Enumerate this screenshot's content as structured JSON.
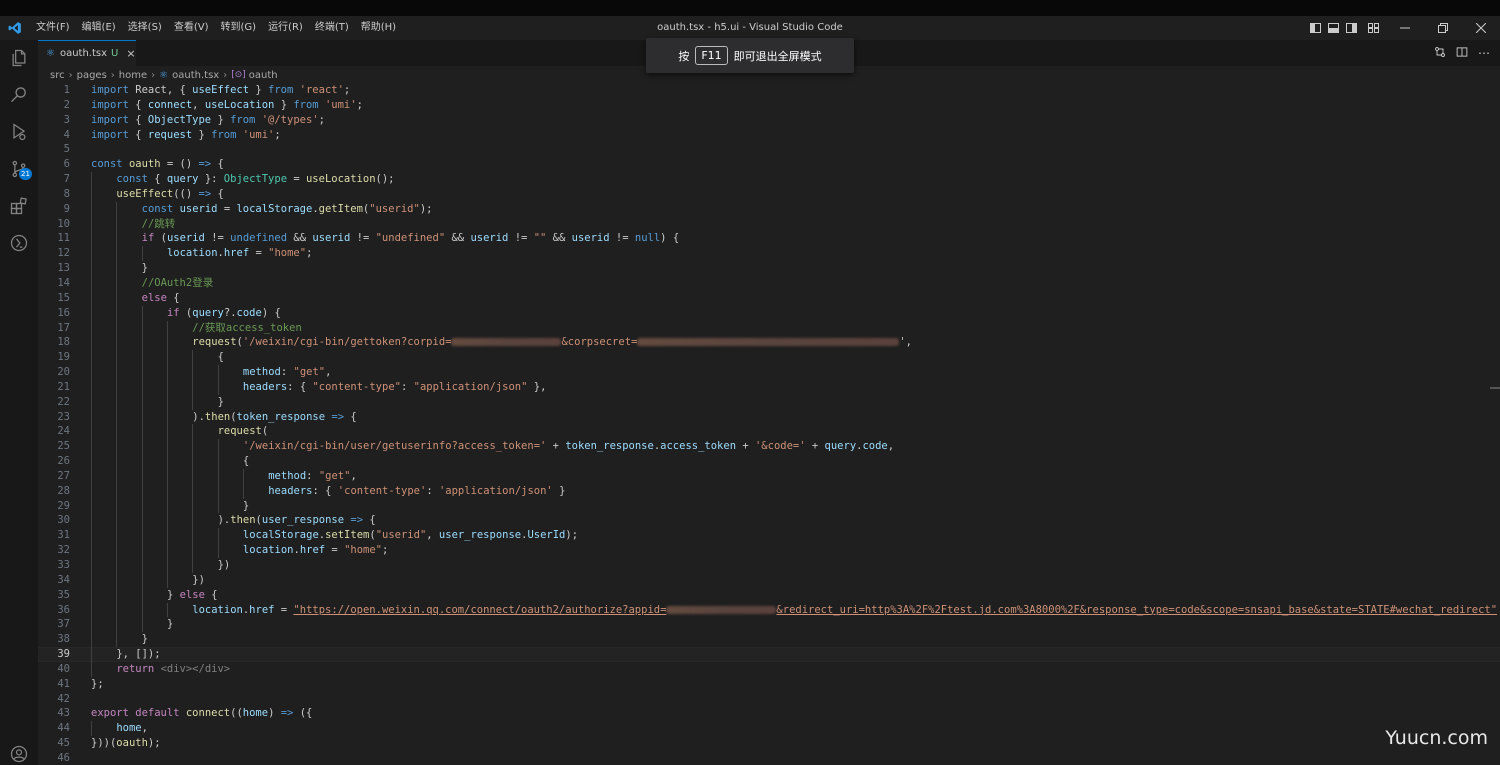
{
  "titlebar": {
    "title": "oauth.tsx - h5.ui - Visual Studio Code",
    "menu": [
      "文件(F)",
      "编辑(E)",
      "选择(S)",
      "查看(V)",
      "转到(G)",
      "运行(R)",
      "终端(T)",
      "帮助(H)"
    ]
  },
  "activitybar": {
    "scm_badge": "21",
    "icons": [
      "explorer-icon",
      "search-icon",
      "run-debug-icon",
      "source-control-icon",
      "extensions-icon",
      "remote-icon",
      "account-icon"
    ]
  },
  "tab": {
    "filename": "oauth.tsx",
    "modified": "U",
    "close": "×"
  },
  "breadcrumb": {
    "items": [
      "src",
      "pages",
      "home",
      "oauth.tsx",
      "oauth"
    ]
  },
  "toast": {
    "prefix": "按",
    "key": "F11",
    "suffix": "即可退出全屏模式"
  },
  "watermark": "Yuucn.com",
  "colors": {
    "keyword": "#569cd6",
    "control": "#c586c0",
    "string": "#ce9178",
    "comment": "#6a9955",
    "function": "#dcdcaa",
    "variable": "#9cdcfe",
    "type": "#4ec9b0",
    "text": "#cccccc",
    "accent": "#0078d4"
  },
  "code": {
    "current_line": 39,
    "lines": [
      {
        "n": 1,
        "indent": 0,
        "tokens": [
          [
            "import",
            "kw"
          ],
          [
            " React, { ",
            "t"
          ],
          [
            "useEffect",
            "var"
          ],
          [
            " } ",
            "t"
          ],
          [
            "from",
            "kw"
          ],
          [
            " ",
            "t"
          ],
          [
            "'react'",
            "str"
          ],
          [
            ";",
            "t"
          ]
        ]
      },
      {
        "n": 2,
        "indent": 0,
        "tokens": [
          [
            "import",
            "kw"
          ],
          [
            " { ",
            "t"
          ],
          [
            "connect",
            "var"
          ],
          [
            ", ",
            "t"
          ],
          [
            "useLocation",
            "var"
          ],
          [
            " } ",
            "t"
          ],
          [
            "from",
            "kw"
          ],
          [
            " ",
            "t"
          ],
          [
            "'umi'",
            "str"
          ],
          [
            ";",
            "t"
          ]
        ]
      },
      {
        "n": 3,
        "indent": 0,
        "tokens": [
          [
            "import",
            "kw"
          ],
          [
            " { ",
            "t"
          ],
          [
            "ObjectType",
            "var"
          ],
          [
            " } ",
            "t"
          ],
          [
            "from",
            "kw"
          ],
          [
            " ",
            "t"
          ],
          [
            "'@/types'",
            "str"
          ],
          [
            ";",
            "t"
          ]
        ]
      },
      {
        "n": 4,
        "indent": 0,
        "tokens": [
          [
            "import",
            "kw"
          ],
          [
            " { ",
            "t"
          ],
          [
            "request",
            "var"
          ],
          [
            " } ",
            "t"
          ],
          [
            "from",
            "kw"
          ],
          [
            " ",
            "t"
          ],
          [
            "'umi'",
            "str"
          ],
          [
            ";",
            "t"
          ]
        ]
      },
      {
        "n": 5,
        "indent": 0,
        "tokens": []
      },
      {
        "n": 6,
        "indent": 0,
        "tokens": [
          [
            "const",
            "kw"
          ],
          [
            " ",
            "t"
          ],
          [
            "oauth",
            "fn"
          ],
          [
            " = () ",
            "t"
          ],
          [
            "=>",
            "kw"
          ],
          [
            " {",
            "t"
          ]
        ]
      },
      {
        "n": 7,
        "indent": 1,
        "tokens": [
          [
            "const",
            "kw"
          ],
          [
            " { ",
            "t"
          ],
          [
            "query",
            "var"
          ],
          [
            " }: ",
            "t"
          ],
          [
            "ObjectType",
            "type"
          ],
          [
            " = ",
            "t"
          ],
          [
            "useLocation",
            "fn"
          ],
          [
            "();",
            "t"
          ]
        ]
      },
      {
        "n": 8,
        "indent": 1,
        "tokens": [
          [
            "useEffect",
            "fn"
          ],
          [
            "(() ",
            "t"
          ],
          [
            "=>",
            "kw"
          ],
          [
            " {",
            "t"
          ]
        ]
      },
      {
        "n": 9,
        "indent": 2,
        "tokens": [
          [
            "const",
            "kw"
          ],
          [
            " ",
            "t"
          ],
          [
            "userid",
            "var"
          ],
          [
            " = ",
            "t"
          ],
          [
            "localStorage",
            "var"
          ],
          [
            ".",
            "t"
          ],
          [
            "getItem",
            "fn"
          ],
          [
            "(",
            "t"
          ],
          [
            "\"userid\"",
            "str"
          ],
          [
            ");",
            "t"
          ]
        ]
      },
      {
        "n": 10,
        "indent": 2,
        "tokens": [
          [
            "//跳转",
            "com"
          ]
        ]
      },
      {
        "n": 11,
        "indent": 2,
        "tokens": [
          [
            "if",
            "ctl"
          ],
          [
            " (",
            "t"
          ],
          [
            "userid",
            "var"
          ],
          [
            " != ",
            "t"
          ],
          [
            "undefined",
            "kw"
          ],
          [
            " && ",
            "t"
          ],
          [
            "userid",
            "var"
          ],
          [
            " != ",
            "t"
          ],
          [
            "\"undefined\"",
            "str"
          ],
          [
            " && ",
            "t"
          ],
          [
            "userid",
            "var"
          ],
          [
            " != ",
            "t"
          ],
          [
            "\"\"",
            "str"
          ],
          [
            " && ",
            "t"
          ],
          [
            "userid",
            "var"
          ],
          [
            " != ",
            "t"
          ],
          [
            "null",
            "kw"
          ],
          [
            ") {",
            "t"
          ]
        ]
      },
      {
        "n": 12,
        "indent": 3,
        "tokens": [
          [
            "location",
            "var"
          ],
          [
            ".",
            "t"
          ],
          [
            "href",
            "var"
          ],
          [
            " = ",
            "t"
          ],
          [
            "\"home\"",
            "str"
          ],
          [
            ";",
            "t"
          ]
        ]
      },
      {
        "n": 13,
        "indent": 2,
        "tokens": [
          [
            "}",
            "t"
          ]
        ]
      },
      {
        "n": 14,
        "indent": 2,
        "tokens": [
          [
            "//OAuth2登录",
            "com"
          ]
        ]
      },
      {
        "n": 15,
        "indent": 2,
        "tokens": [
          [
            "else",
            "ctl"
          ],
          [
            " {",
            "t"
          ]
        ]
      },
      {
        "n": 16,
        "indent": 3,
        "tokens": [
          [
            "if",
            "ctl"
          ],
          [
            " (",
            "t"
          ],
          [
            "query",
            "var"
          ],
          [
            "?.",
            "t"
          ],
          [
            "code",
            "var"
          ],
          [
            ") {",
            "t"
          ]
        ]
      },
      {
        "n": 17,
        "indent": 4,
        "tokens": [
          [
            "//获取access_token",
            "com"
          ]
        ]
      },
      {
        "n": 18,
        "indent": 4,
        "tokens": [
          [
            "request",
            "fn"
          ],
          [
            "(",
            "t"
          ],
          [
            "'/weixin/cgi-bin/gettoken?corpid=",
            "str"
          ],
          [
            "",
            "blur:110"
          ],
          [
            "&corpsecret=",
            "str"
          ],
          [
            "",
            "blur:262"
          ],
          [
            "',",
            "t"
          ]
        ]
      },
      {
        "n": 19,
        "indent": 5,
        "tokens": [
          [
            "{",
            "t"
          ]
        ]
      },
      {
        "n": 20,
        "indent": 6,
        "tokens": [
          [
            "method",
            "var"
          ],
          [
            ": ",
            "t"
          ],
          [
            "\"get\"",
            "str"
          ],
          [
            ",",
            "t"
          ]
        ]
      },
      {
        "n": 21,
        "indent": 6,
        "tokens": [
          [
            "headers",
            "var"
          ],
          [
            ": { ",
            "t"
          ],
          [
            "\"content-type\"",
            "str"
          ],
          [
            ": ",
            "t"
          ],
          [
            "\"application/json\"",
            "str"
          ],
          [
            " },",
            "t"
          ]
        ]
      },
      {
        "n": 22,
        "indent": 5,
        "tokens": [
          [
            "}",
            "t"
          ]
        ]
      },
      {
        "n": 23,
        "indent": 4,
        "tokens": [
          [
            ").",
            "t"
          ],
          [
            "then",
            "fn"
          ],
          [
            "(",
            "t"
          ],
          [
            "token_response",
            "var"
          ],
          [
            " ",
            "t"
          ],
          [
            "=>",
            "kw"
          ],
          [
            " {",
            "t"
          ]
        ]
      },
      {
        "n": 24,
        "indent": 5,
        "tokens": [
          [
            "request",
            "fn"
          ],
          [
            "(",
            "t"
          ]
        ]
      },
      {
        "n": 25,
        "indent": 6,
        "tokens": [
          [
            "'/weixin/cgi-bin/user/getuserinfo?access_token='",
            "str"
          ],
          [
            " + ",
            "t"
          ],
          [
            "token_response",
            "var"
          ],
          [
            ".",
            "t"
          ],
          [
            "access_token",
            "var"
          ],
          [
            " + ",
            "t"
          ],
          [
            "'&code='",
            "str"
          ],
          [
            " + ",
            "t"
          ],
          [
            "query",
            "var"
          ],
          [
            ".",
            "t"
          ],
          [
            "code",
            "var"
          ],
          [
            ",",
            "t"
          ]
        ]
      },
      {
        "n": 26,
        "indent": 6,
        "tokens": [
          [
            "{",
            "t"
          ]
        ]
      },
      {
        "n": 27,
        "indent": 7,
        "tokens": [
          [
            "method",
            "var"
          ],
          [
            ": ",
            "t"
          ],
          [
            "\"get\"",
            "str"
          ],
          [
            ",",
            "t"
          ]
        ]
      },
      {
        "n": 28,
        "indent": 7,
        "tokens": [
          [
            "headers",
            "var"
          ],
          [
            ": { ",
            "t"
          ],
          [
            "'content-type'",
            "str"
          ],
          [
            ": ",
            "t"
          ],
          [
            "'application/json'",
            "str"
          ],
          [
            " }",
            "t"
          ]
        ]
      },
      {
        "n": 29,
        "indent": 6,
        "tokens": [
          [
            "}",
            "t"
          ]
        ]
      },
      {
        "n": 30,
        "indent": 5,
        "tokens": [
          [
            ").",
            "t"
          ],
          [
            "then",
            "fn"
          ],
          [
            "(",
            "t"
          ],
          [
            "user_response",
            "var"
          ],
          [
            " ",
            "t"
          ],
          [
            "=>",
            "kw"
          ],
          [
            " {",
            "t"
          ]
        ]
      },
      {
        "n": 31,
        "indent": 6,
        "tokens": [
          [
            "localStorage",
            "var"
          ],
          [
            ".",
            "t"
          ],
          [
            "setItem",
            "fn"
          ],
          [
            "(",
            "t"
          ],
          [
            "\"userid\"",
            "str"
          ],
          [
            ", ",
            "t"
          ],
          [
            "user_response",
            "var"
          ],
          [
            ".",
            "t"
          ],
          [
            "UserId",
            "var"
          ],
          [
            ");",
            "t"
          ]
        ]
      },
      {
        "n": 32,
        "indent": 6,
        "tokens": [
          [
            "location",
            "var"
          ],
          [
            ".",
            "t"
          ],
          [
            "href",
            "var"
          ],
          [
            " = ",
            "t"
          ],
          [
            "\"home\"",
            "str"
          ],
          [
            ";",
            "t"
          ]
        ]
      },
      {
        "n": 33,
        "indent": 5,
        "tokens": [
          [
            "})",
            "t"
          ]
        ]
      },
      {
        "n": 34,
        "indent": 4,
        "tokens": [
          [
            "})",
            "t"
          ]
        ]
      },
      {
        "n": 35,
        "indent": 3,
        "tokens": [
          [
            "} ",
            "t"
          ],
          [
            "else",
            "ctl"
          ],
          [
            " {",
            "t"
          ]
        ]
      },
      {
        "n": 36,
        "indent": 4,
        "tokens": [
          [
            "location",
            "var"
          ],
          [
            ".",
            "t"
          ],
          [
            "href",
            "var"
          ],
          [
            " = ",
            "t"
          ],
          [
            "\"https://open.weixin.qq.com/connect/oauth2/authorize?appid=",
            "link"
          ],
          [
            "",
            "blur:110"
          ],
          [
            "&redirect_uri=http%3A%2F%2Ftest.jd.com%3A8000%2F&response_type=code&scope=snsapi_base&state=STATE#wechat_redirect\"",
            "link"
          ]
        ]
      },
      {
        "n": 37,
        "indent": 3,
        "tokens": [
          [
            "}",
            "t"
          ]
        ]
      },
      {
        "n": 38,
        "indent": 2,
        "tokens": [
          [
            "}",
            "t"
          ]
        ]
      },
      {
        "n": 39,
        "indent": 1,
        "tokens": [
          [
            "}, []);",
            "t"
          ]
        ]
      },
      {
        "n": 40,
        "indent": 1,
        "tokens": [
          [
            "return",
            "ctl"
          ],
          [
            " ",
            "t"
          ],
          [
            "<div></div>",
            "tag"
          ]
        ]
      },
      {
        "n": 41,
        "indent": 0,
        "tokens": [
          [
            "};",
            "t"
          ]
        ]
      },
      {
        "n": 42,
        "indent": 0,
        "tokens": []
      },
      {
        "n": 43,
        "indent": 0,
        "tokens": [
          [
            "export",
            "ctl"
          ],
          [
            " ",
            "t"
          ],
          [
            "default",
            "ctl"
          ],
          [
            " ",
            "t"
          ],
          [
            "connect",
            "fn"
          ],
          [
            "((",
            "t"
          ],
          [
            "home",
            "var"
          ],
          [
            ") ",
            "t"
          ],
          [
            "=>",
            "kw"
          ],
          [
            " ({",
            "t"
          ]
        ]
      },
      {
        "n": 44,
        "indent": 1,
        "tokens": [
          [
            "home",
            "var"
          ],
          [
            ",",
            "t"
          ]
        ]
      },
      {
        "n": 45,
        "indent": 0,
        "tokens": [
          [
            "}))(",
            "t"
          ],
          [
            "oauth",
            "fn"
          ],
          [
            ");",
            "t"
          ]
        ]
      },
      {
        "n": 46,
        "indent": 0,
        "tokens": []
      }
    ]
  }
}
